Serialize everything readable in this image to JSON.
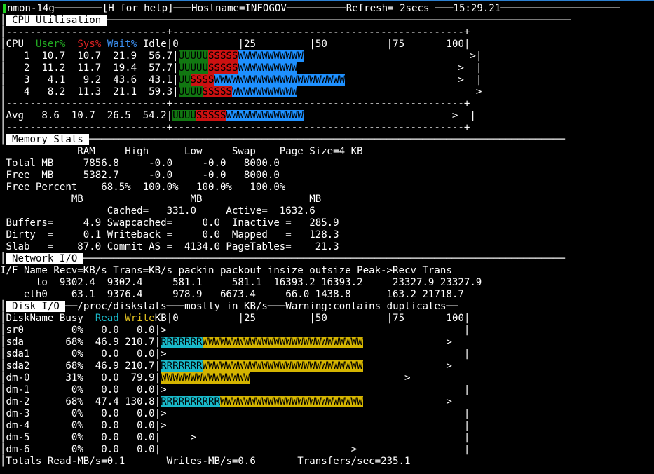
{
  "window": {
    "app": "nmon-14g",
    "help": "[H for help]",
    "hostname": "Hostname=INFOGOV",
    "refresh": "Refresh= 2secs",
    "time": "15:29.21"
  },
  "cpu": {
    "header_label": "CPU Utilisation",
    "dash_line": "---------------------------+-------------------------------------------------+",
    "col_cpu": "CPU",
    "col_user": "User%",
    "col_sys": "Sys%",
    "col_wait": "Wait%",
    "col_idle": "Idle",
    "scale": "|0          |25         |50          |75       100|",
    "rows": [
      {
        "cpu": "1",
        "user": "10.7",
        "sys": "10.7",
        "wait": "21.9",
        "idle": "56.7",
        "u": "UUUUU",
        "s": "SSSSS",
        "w": "WWWWWWWWWWW",
        "tail": ">|"
      },
      {
        "cpu": "2",
        "user": "11.2",
        "sys": "11.7",
        "wait": "19.4",
        "idle": "57.7",
        "u": "UUUUU",
        "s": "SSSSS",
        "w": "WWWWWWWWWW",
        "tail": ">  |"
      },
      {
        "cpu": "3",
        "user": "4.1",
        "sys": "9.2",
        "wait": "43.6",
        "idle": "43.1",
        "u": "UU",
        "s": "SSSS",
        "w": "WWWWWWWWWWWWWWWWWWWWWW",
        "tail": ">  |"
      },
      {
        "cpu": "4",
        "user": "8.2",
        "sys": "11.3",
        "wait": "21.1",
        "idle": "59.3",
        "u": "UUUU",
        "s": "SSSSS",
        "w": "WWWWWWWWWWW",
        "tail": ">"
      }
    ],
    "avg": {
      "label": "Avg",
      "user": "8.6",
      "sys": "10.7",
      "wait": "26.5",
      "idle": "54.2",
      "u": "UUUU",
      "s": "SSSSS",
      "w": "WWWWWWWWWWWWW",
      "tail": ">  |"
    }
  },
  "memory": {
    "header_label": "Memory Stats",
    "lines": [
      "             RAM     High      Low     Swap    Page Size=4 KB",
      " Total MB     7856.8     -0.0     -0.0   8000.0",
      " Free  MB     5382.7     -0.0     -0.0   8000.0",
      " Free Percent    68.5%  100.0%   100.0%   100.0%",
      "            MB                  MB                  MB",
      "                  Cached=   331.0     Active=  1632.6",
      " Buffers=     4.9 Swapcached=     0.0  Inactive =   285.9",
      " Dirty  =     0.1 Writeback =     0.0  Mapped   =   128.3",
      " Slab   =    87.0 Commit_AS =  4134.0 PageTables=    21.3"
    ]
  },
  "network": {
    "header_label": "Network I/O",
    "lines": [
      "I/F Name Recv=KB/s Trans=KB/s packin packout insize outsize Peak->Recv Trans",
      "      lo  9302.4  9302.4     581.1     581.1  16393.2 16393.2     23327.9 23327.9",
      "    eth0    63.1  9376.4     978.9   6673.4     66.0 1438.8      163.2 21718.7"
    ]
  },
  "disk": {
    "header_label": "Disk I/O",
    "path": "/proc/diskstats",
    "mostly": "mostly in KB/s",
    "warning": "Warning:contains duplicates",
    "col_name": "DiskName",
    "col_busy": "Busy",
    "col_read": "Read",
    "col_write": "Write",
    "col_kb": "KB",
    "scale": "|0          |25         |50          |75       100|",
    "rows": [
      {
        "name": "sr0",
        "busy": "0%",
        "read": "0.0",
        "write": "0.0",
        "r": "",
        "w": "",
        "bar": ">",
        "pad": "                                                  ",
        "tail": "|"
      },
      {
        "name": "sda",
        "busy": "68%",
        "read": "46.9",
        "write": "210.7",
        "r": "RRRRRRR",
        "w": "WWWWWWWWWWWWWWWWWWWWWWWWWWW",
        "bar": "",
        "pad": "              ",
        "tail": ">"
      },
      {
        "name": "sda1",
        "busy": "0%",
        "read": "0.0",
        "write": "0.0",
        "r": "",
        "w": "",
        "bar": ">",
        "pad": "                                                  ",
        "tail": "|"
      },
      {
        "name": "sda2",
        "busy": "68%",
        "read": "46.9",
        "write": "210.7",
        "r": "RRRRRRR",
        "w": "WWWWWWWWWWWWWWWWWWWWWWWWWWW",
        "bar": "",
        "pad": "              ",
        "tail": ">"
      },
      {
        "name": "dm-0",
        "busy": "31%",
        "read": "0.0",
        "write": "79.9",
        "r": "",
        "w": "WWWWWWWWWWWWWWW",
        "bar": "",
        "pad": "                          ",
        "tail": ">"
      },
      {
        "name": "dm-1",
        "busy": "0%",
        "read": "0.0",
        "write": "0.0",
        "r": "",
        "w": "",
        "bar": ">",
        "pad": "                                                  ",
        "tail": "|"
      },
      {
        "name": "dm-2",
        "busy": "68%",
        "read": "47.4",
        "write": "130.8",
        "r": "RRRRRRRRRR",
        "w": "WWWWWWWWWWWWWWWWWWWWWWWW",
        "bar": "",
        "pad": "              ",
        "tail": ">"
      },
      {
        "name": "dm-3",
        "busy": "0%",
        "read": "0.0",
        "write": "0.0",
        "r": "",
        "w": "",
        "bar": ">",
        "pad": "                                                  ",
        "tail": "|"
      },
      {
        "name": "dm-4",
        "busy": "0%",
        "read": "0.0",
        "write": "0.0",
        "r": "",
        "w": "",
        "bar": ">",
        "pad": "                                                  ",
        "tail": "|"
      },
      {
        "name": "dm-5",
        "busy": "0%",
        "read": "0.0",
        "write": "0.0",
        "r": "",
        "w": "",
        "bar": "     >",
        "pad": "                                             ",
        "tail": "|"
      },
      {
        "name": "dm-6",
        "busy": "0%",
        "read": "0.0",
        "write": "0.0",
        "r": "",
        "w": "",
        "bar": "                                >",
        "pad": "                  ",
        "tail": "|"
      }
    ],
    "totals": "Totals Read-MB/s=0.1       Writes-MB/s=0.6       Transfers/sec=235.1"
  },
  "colors": {
    "user": "#117711",
    "sys": "#cc1111",
    "wait": "#1e90ff",
    "read": "#19b8c8",
    "write": "#d4b400",
    "cursor": "#1fd01f"
  }
}
